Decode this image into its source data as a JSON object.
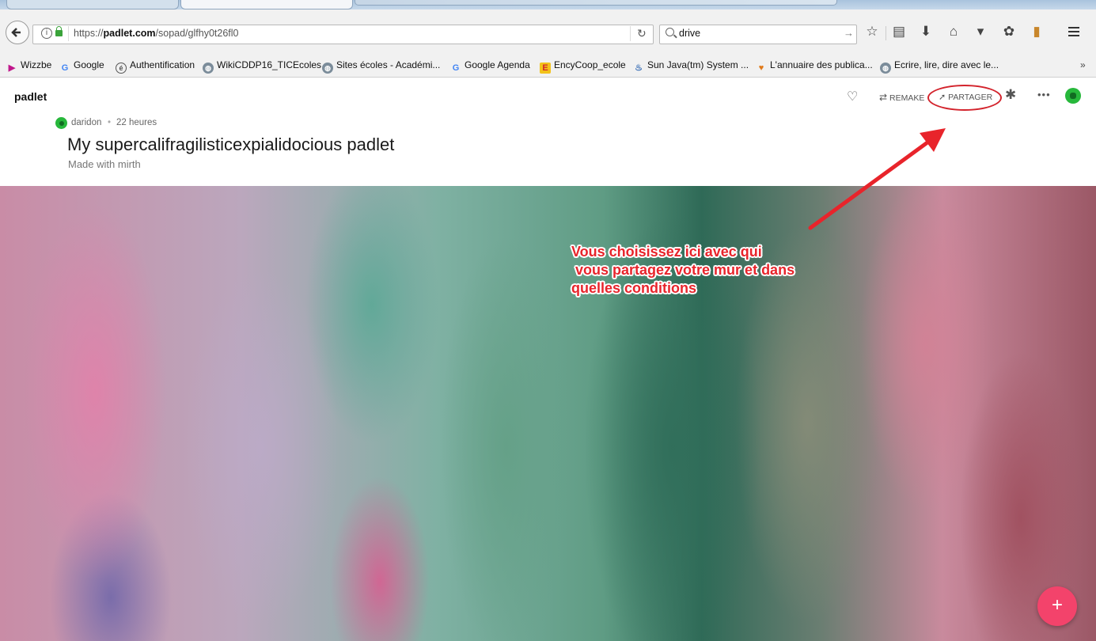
{
  "browser": {
    "url_prefix": "https://",
    "url_domain": "padlet.com",
    "url_path": "/sopad/glfhy0t26fl0",
    "search_value": "drive",
    "bookmarks": [
      {
        "label": "Wizzbe",
        "icon": "wizzbe-icon"
      },
      {
        "label": "Google",
        "icon": "google-icon"
      },
      {
        "label": "Authentification",
        "icon": "auth-icon"
      },
      {
        "label": "WikiCDDP16_TICEcoles",
        "icon": "globe-icon"
      },
      {
        "label": "Sites écoles - Académi...",
        "icon": "globe-icon"
      },
      {
        "label": "Google Agenda",
        "icon": "google-icon"
      },
      {
        "label": "EncyCoop_ecole",
        "icon": "encycoop-icon"
      },
      {
        "label": "Sun Java(tm) System ...",
        "icon": "java-icon"
      },
      {
        "label": "L'annuaire des publica...",
        "icon": "annuaire-icon"
      },
      {
        "label": "Ecrire, lire, dire avec le...",
        "icon": "globe-icon"
      }
    ],
    "bookmarks_more": "»"
  },
  "padlet": {
    "logo": "padlet",
    "actions": {
      "remake": "REMAKE",
      "share": "PARTAGER"
    },
    "author": "daridon",
    "separator": "•",
    "time": "22 heures",
    "title": "My supercalifragilisticexpialidocious padlet",
    "subtitle": "Made with mirth",
    "fab_label": "+"
  },
  "annotation": {
    "text": "Vous choisissez ici avec qui\n vous partagez votre mur et dans\nquelles conditions",
    "color": "#e8242b"
  },
  "colors": {
    "fab": "#f3436b",
    "annotation_red": "#d3232c",
    "avatar": "#27b83b"
  }
}
